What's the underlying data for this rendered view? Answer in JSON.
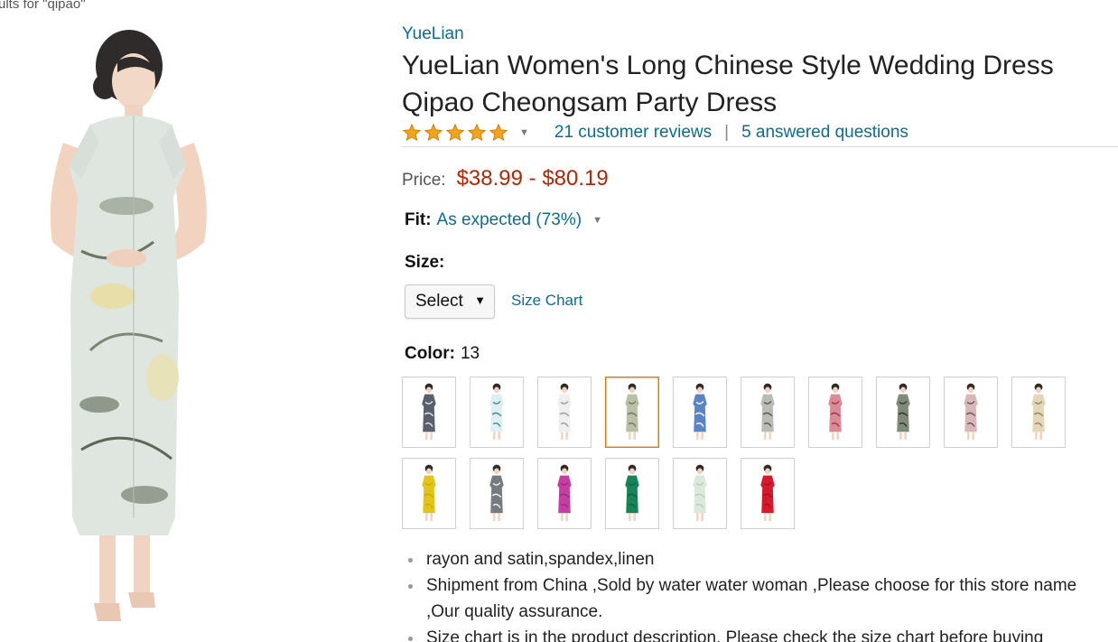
{
  "search": {
    "breadcrumb": "ults for \"qipao\""
  },
  "product": {
    "brand": "YueLian",
    "title_line1": "YueLian Women's Long Chinese Style Wedding Dress",
    "title_line2": "Qipao Cheongsam Party Dress",
    "rating": {
      "stars": 5,
      "reviews_link": "21 customer reviews",
      "separator": "|",
      "questions_link": "5 answered questions"
    },
    "price": {
      "label": "Price:",
      "value": "$38.99 - $80.19"
    },
    "fit": {
      "label": "Fit:",
      "value": "As expected (73%)"
    },
    "size": {
      "label": "Size:",
      "selected": "Select",
      "chart_link": "Size Chart"
    },
    "color": {
      "label": "Color:",
      "count": "13",
      "swatches": [
        {
          "name": "black-floral",
          "dress_color": "#5a5f6e",
          "pattern_color": "#e6e6e6"
        },
        {
          "name": "teal-floral",
          "dress_color": "#dfeef0",
          "pattern_color": "#3b8a97"
        },
        {
          "name": "white-floral",
          "dress_color": "#efefef",
          "pattern_color": "#9a9a9a"
        },
        {
          "name": "green-lotus",
          "dress_color": "#b9c0a3",
          "pattern_color": "#6f7560",
          "selected": true
        },
        {
          "name": "blue-white",
          "dress_color": "#5b84c4",
          "pattern_color": "#ffffff"
        },
        {
          "name": "grey-floral",
          "dress_color": "#b9bcb3",
          "pattern_color": "#555"
        },
        {
          "name": "red-floral",
          "dress_color": "#d98b98",
          "pattern_color": "#b3283e"
        },
        {
          "name": "dark-green-floral",
          "dress_color": "#7f8a77",
          "pattern_color": "#333"
        },
        {
          "name": "pink-floral",
          "dress_color": "#d8b6b9",
          "pattern_color": "#6f5357"
        },
        {
          "name": "beige-floral",
          "dress_color": "#e4d6b8",
          "pattern_color": "#9a8150"
        },
        {
          "name": "yellow",
          "dress_color": "#e2c51b",
          "pattern_color": "#c9aa05"
        },
        {
          "name": "black-white-floral",
          "dress_color": "#777b80",
          "pattern_color": "#f0f0f0"
        },
        {
          "name": "magenta",
          "dress_color": "#c53ea3",
          "pattern_color": "#9e2780"
        },
        {
          "name": "green",
          "dress_color": "#17845a",
          "pattern_color": "#0e6344"
        },
        {
          "name": "light-mint",
          "dress_color": "#dbe9dc",
          "pattern_color": "#b7cdb8"
        },
        {
          "name": "red",
          "dress_color": "#d9182c",
          "pattern_color": "#a80f1f"
        }
      ]
    },
    "features": [
      "rayon and satin,spandex,linen",
      "Shipment from China ,Sold by water water woman ,Please choose for this store name",
      ",Our quality assurance.",
      "Size chart is in the product description, Please check the size chart before buying"
    ]
  },
  "colors": {
    "link": "#0f6b8f",
    "price": "#b12704",
    "star": "#f4a41c",
    "selected_border": "#e47911"
  }
}
